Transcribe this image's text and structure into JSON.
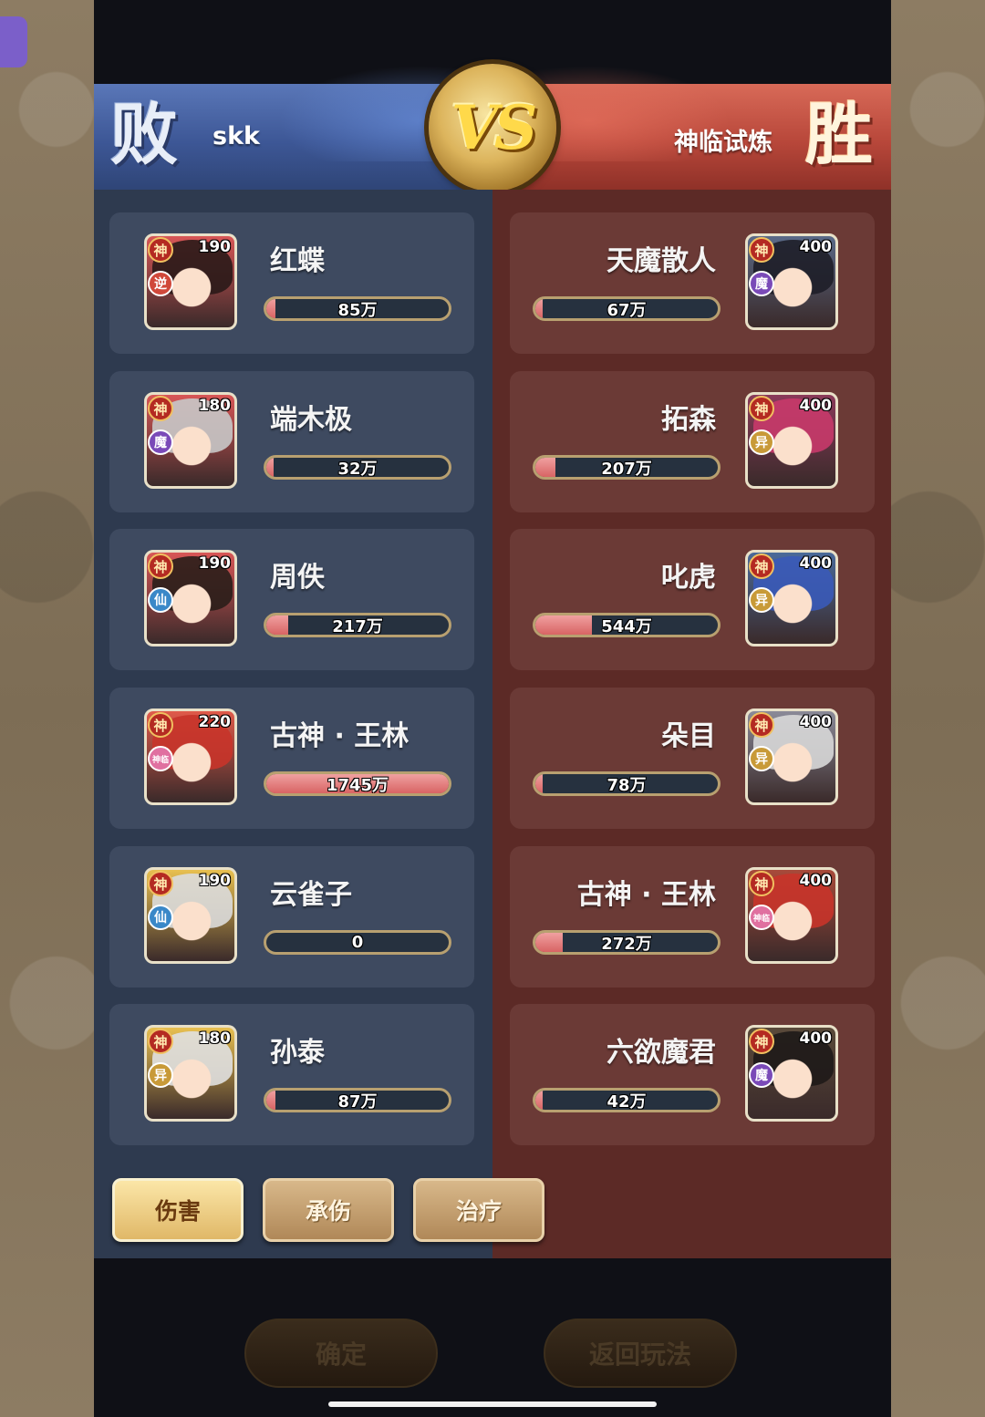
{
  "header": {
    "left_result": "败",
    "left_team": "skk",
    "vs": "VS",
    "right_team": "神临试炼",
    "right_result": "胜"
  },
  "left_heroes": [
    {
      "name": "红蝶",
      "level": "190",
      "god": "神",
      "faction": "逆",
      "faction_color": "#d0483a",
      "value": "85万",
      "fill": 0.05,
      "frame": "#d85656",
      "hair": "#2a1a18"
    },
    {
      "name": "端木极",
      "level": "180",
      "god": "神",
      "faction": "魔",
      "faction_color": "#7a4ab8",
      "value": "32万",
      "fill": 0.02,
      "frame": "#d85656",
      "hair": "#c8c8c8"
    },
    {
      "name": "周佚",
      "level": "190",
      "god": "神",
      "faction": "仙",
      "faction_color": "#3a88c8",
      "value": "217万",
      "fill": 0.12,
      "frame": "#d85656",
      "hair": "#2a1e1a"
    },
    {
      "name": "古神 · 王林",
      "level": "220",
      "god": "神",
      "faction": "神临",
      "faction_color": "#e070a0",
      "value": "1745万",
      "fill": 1.0,
      "frame": "#e05a4a",
      "hair": "#c8342a"
    },
    {
      "name": "云雀子",
      "level": "190",
      "god": "神",
      "faction": "仙",
      "faction_color": "#3a88c8",
      "value": "0",
      "fill": 0.0,
      "frame": "#e8c050",
      "hair": "#dcdcdc"
    },
    {
      "name": "孙泰",
      "level": "180",
      "god": "神",
      "faction": "异",
      "faction_color": "#c89a38",
      "value": "87万",
      "fill": 0.05,
      "frame": "#e8c050",
      "hair": "#e0e0e0"
    }
  ],
  "right_heroes": [
    {
      "name": "天魔散人",
      "level": "400",
      "god": "神",
      "faction": "魔",
      "faction_color": "#7a4ab8",
      "value": "67万",
      "fill": 0.03,
      "frame": "#5a6a88",
      "hair": "#1e1e28"
    },
    {
      "name": "拓森",
      "level": "400",
      "god": "神",
      "faction": "异",
      "faction_color": "#c89a38",
      "value": "207万",
      "fill": 0.11,
      "frame": "#8a3a5a",
      "hair": "#c83a6a"
    },
    {
      "name": "叱虎",
      "level": "400",
      "god": "神",
      "faction": "异",
      "faction_color": "#c89a38",
      "value": "544万",
      "fill": 0.31,
      "frame": "#4a6a9a",
      "hair": "#3a5ab8"
    },
    {
      "name": "朵目",
      "level": "400",
      "god": "神",
      "faction": "异",
      "faction_color": "#c89a38",
      "value": "78万",
      "fill": 0.04,
      "frame": "#8a8a98",
      "hair": "#d8d8d8"
    },
    {
      "name": "古神 · 王林",
      "level": "400",
      "god": "神",
      "faction": "神临",
      "faction_color": "#e070a0",
      "value": "272万",
      "fill": 0.15,
      "frame": "#a84a3a",
      "hair": "#c8342a"
    },
    {
      "name": "六欲魔君",
      "level": "400",
      "god": "神",
      "faction": "魔",
      "faction_color": "#7a4ab8",
      "value": "42万",
      "fill": 0.02,
      "frame": "#5a4a3a",
      "hair": "#1e1a18"
    }
  ],
  "tabs": [
    {
      "label": "伤害",
      "active": true
    },
    {
      "label": "承伤",
      "active": false
    },
    {
      "label": "治疗",
      "active": false
    }
  ],
  "bottom": {
    "confirm_label": "确定",
    "return_label": "返回玩法"
  }
}
